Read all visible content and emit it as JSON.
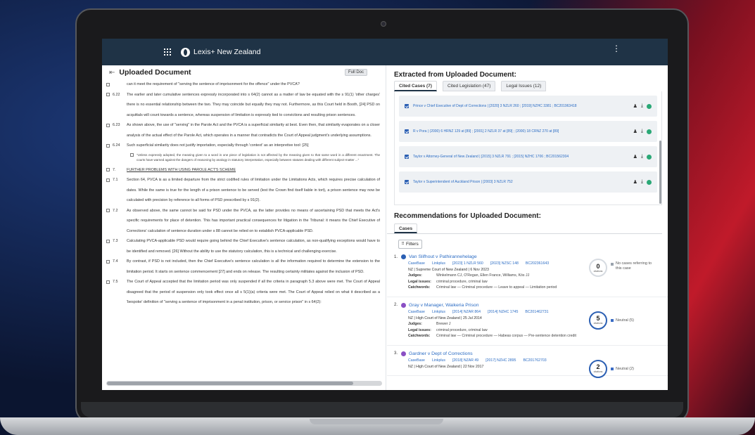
{
  "app": {
    "brand": "Lexis+ New Zealand"
  },
  "doc_panel": {
    "title": "Uploaded Document",
    "full_doc_button": "Full Doc",
    "paragraphs": [
      {
        "num": "",
        "text": "can it meet the requirement of \"serving the sentence of imprisonment for the offence\" under the PVCA?"
      },
      {
        "num": "6.22",
        "text": "The earlier and later cumulative sentences expressly incorporated into s 64(2) cannot as a matter of law be equated with the s 91(1) 'other charges' there is no essential relationship between the two. They may coincide but equally they may not. Furthermore, as this Court held in Booth, [24] PSD on acquittals will count towards a sentence, whereas suspension of limitation is expressly tied to convictions and resulting prison sentences."
      },
      {
        "num": "6.23",
        "text": "As shown above, the use of \"serving\" in the Parole Act and the PVCA is a superficial similarity at best. Even then, that similarity evaporates on a closer analysis of the actual effect of the Parole Act, which operates in a manner that contradicts the Court of Appeal judgment's underlying assumptions."
      },
      {
        "num": "6.24",
        "text": "Such superficial similarity does not justify importation, especially through 'context' as an interpretive tool: [25]"
      }
    ],
    "quote": "\"Unless expressly adopted, the meaning given to a word in one piece of legislation is not affected by the meaning given to that same word in a different enactment. The courts have warned against the dangers of reasoning by analogy in statutory interpretation, especially between statutes dealing with different subject-matter ...\"",
    "section_heading": {
      "num": "7.",
      "text": "FURTHER PROBLEMS WITH USING PAROLE ACT'S SCHEME"
    },
    "paragraphs2": [
      {
        "num": "7.1",
        "text": "Section 64, PVCA is as a limited departure from the strict codified rules of limitation under the Limitations Acts, which requires precise calculation of dates. While the same is true for the length of a prison sentence to be served (lest the Crown find itself liable in tort), a prison sentence may now be calculated with precision by reference to all forms of PSD prescribed by s 91(2)."
      },
      {
        "num": "7.2",
        "text": "As observed above, the same cannot be said for PSD under the PVCA, as the latter provides no means of ascertaining PSD that meets the Act's specific requirements for place of detention. This has important practical consequences for litigation in the Tribunal: it means the Chief Executive of Corrections' calculation of sentence duration under s 88 cannot be relied on to establish PVCA-applicable PSD."
      },
      {
        "num": "7.3",
        "text": "Calculating PVCA-applicable PSD would require going behind the Chief Executive's sentence calculation, as non-qualifying exceptions would have to be identified and removed. [26] Without the ability to use the statutory calculation, this is a technical and challenging exercise."
      },
      {
        "num": "7.4",
        "text": "By contrast, if PSD is not included, then the Chief Executive's sentence calculation is all the information required to determine the extension to the limitation period. It starts on sentence commencement [27] and ends on release. The resulting certainty militates against the inclusion of PSD."
      },
      {
        "num": "7.5",
        "text": "The Court of Appeal accepted that the limitation period was only suspended if all the criteria in paragraph 5.3 above were met. The Court of Appeal disagreed that the period of suspension only took effect once all s 5(1)(a) criteria were met. The Court of Appeal relied on what it described as a 'bespoke' definition of \"serving a sentence of imprisonment in a penal institution, prison, or service prison\" in s 64(2):"
      }
    ]
  },
  "extracted": {
    "title": "Extracted from Uploaded Document:",
    "tabs": [
      "Cited Cases (7)",
      "Cited Legislation (47)",
      "Legal Issues (12)"
    ],
    "cases": [
      "Prince v Chief Executive of Dept of Corrections | [2020] 3 NZLR 260 ; [2019] NZHC 3381 ; BC201963418",
      "R v Pora | (2000) 6 HRNZ 129 at [89] ; [2001] 2 NZLR 37 at [89] ; (2000) 18 CRNZ 270 at [89]",
      "Taylor v Attorney-General of New Zealand | [2015] 3 NZLR 791 ; [2015] NZHC 1706 ; BC201562304",
      "Taylor v Superintendent of Auckland Prison | [2003] 3 NZLR 752"
    ]
  },
  "recommendations": {
    "title": "Recommendations for Uploaded Document:",
    "tab": "Cases",
    "filters_label": "Filters",
    "items": [
      {
        "num": "1.",
        "name": "Van Slifhout v Pathirannehelage",
        "links": [
          "CaseBase",
          "Linkplus",
          "[2023] 1 NZLR 560",
          "[2023] NZSC 148",
          "BC202361643"
        ],
        "court": "NZ | Supreme Court of New Zealand | 6 Nov 2023",
        "judges": "Winkelmann CJ, O'Regan, Ellen France, Williams, Kós JJ",
        "legal_issues": "criminal procedure, criminal law",
        "catchwords": "Criminal law — Criminal procedure — Leave to appeal — Limitation period",
        "citations": "0",
        "citations_label": "citations",
        "note": "No cases referring to this case",
        "dot_color": "#2b5fb3"
      },
      {
        "num": "2.",
        "name": "Gray v Manager, Waikeria Prison",
        "links": [
          "CaseBase",
          "Linkplus",
          "[2014] NZAR 864",
          "[2014] NZHC 1745",
          "BC201462731"
        ],
        "court": "NZ | High Court of New Zealand | 25 Jul 2014",
        "judges": "Brewer J",
        "legal_issues": "criminal procedure, criminal law",
        "catchwords": "Criminal law — Criminal procedure — Habeas corpus — Pre-sentence detention credit",
        "citations": "5",
        "citations_label": "citations",
        "note": "Neutral (5)",
        "dot_color": "#8a4fc4"
      },
      {
        "num": "3.",
        "name": "Gardner v Dept of Corrections",
        "links": [
          "CaseBase",
          "Linkplus",
          "[2018] NZAR 49",
          "[2017] NZHC 2895",
          "BC201762703"
        ],
        "court": "NZ | High Court of New Zealand | 22 Nov 2017",
        "citations": "2",
        "citations_label": "citations",
        "note": "Neutral (2)",
        "dot_color": "#8a4fc4"
      }
    ],
    "labels": {
      "judges": "Judges:",
      "legal_issues": "Legal issues:",
      "catchwords": "Catchwords:"
    }
  },
  "colors": {
    "topbar": "#1f3346",
    "link": "#2b6cc4",
    "check": "#2b5fb3",
    "ok": "#2aa876"
  }
}
